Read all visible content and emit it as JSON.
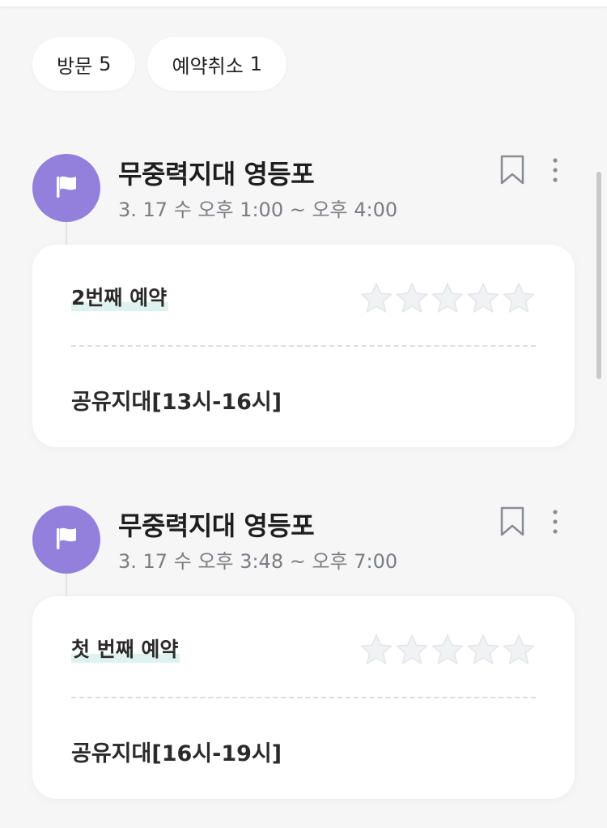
{
  "filters": [
    {
      "label": "방문",
      "count": "5"
    },
    {
      "label": "예약취소",
      "count": "1"
    }
  ],
  "entries": [
    {
      "place": "무중력지대 영등포",
      "time": "3. 17 수 오후 1:00 ~ 오후 4:00",
      "order": "2번째 예약",
      "space": "공유지대[13시-16시]",
      "rating": 0
    },
    {
      "place": "무중력지대 영등포",
      "time": "3. 17 수 오후 3:48 ~ 오후 7:00",
      "order": "첫 번째 예약",
      "space": "공유지대[16시-19시]",
      "rating": 0
    }
  ],
  "icons": {
    "place": "flag-icon",
    "bookmark": "bookmark-icon",
    "more": "more-vertical-icon",
    "rating": "star-icon"
  },
  "colors": {
    "accent": "#9380dc",
    "highlight": "#def3ee",
    "star_empty": "#eceef1",
    "background": "#f6f6f6"
  }
}
